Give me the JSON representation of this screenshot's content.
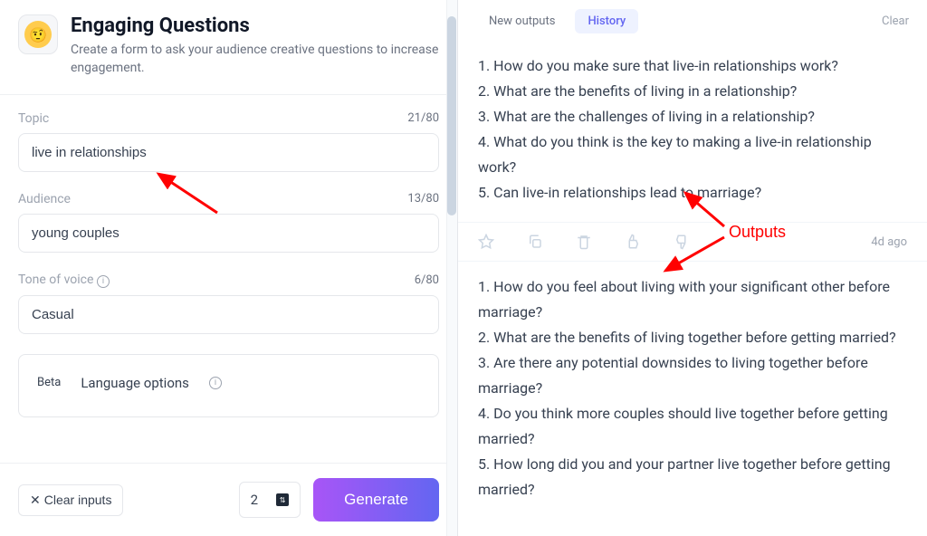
{
  "header": {
    "title": "Engaging Questions",
    "subtitle": "Create a form to ask your audience creative questions to increase engagement."
  },
  "form": {
    "topic": {
      "label": "Topic",
      "value": "live in relationships",
      "counter": "21/80"
    },
    "audience": {
      "label": "Audience",
      "value": "young couples",
      "counter": "13/80"
    },
    "tone": {
      "label": "Tone of voice",
      "value": "Casual",
      "counter": "6/80"
    },
    "lang": {
      "beta": "Beta",
      "label": "Language options"
    }
  },
  "footer": {
    "clear": "Clear inputs",
    "count": "2",
    "generate": "Generate"
  },
  "tabs": {
    "newOutputs": "New outputs",
    "history": "History",
    "clear": "Clear"
  },
  "results": {
    "first": [
      "1. How do you make sure that live-in relationships work?",
      "2. What are the benefits of living in a relationship?",
      "3. What are the challenges of living in a relationship?",
      "4. What do you think is the key to making a live-in relationship work?",
      "5. Can live-in relationships lead to marriage?"
    ],
    "time": "4d ago",
    "second": [
      "1. How do you feel about living with your significant other before marriage?",
      "2. What are the benefits of living together before getting married?",
      "3. Are there any potential downsides to living together before marriage?",
      "4. Do you think more couples should live together before getting married?",
      "5. How long did you and your partner live together before getting married?"
    ]
  },
  "annotation": {
    "label": "Outputs"
  }
}
